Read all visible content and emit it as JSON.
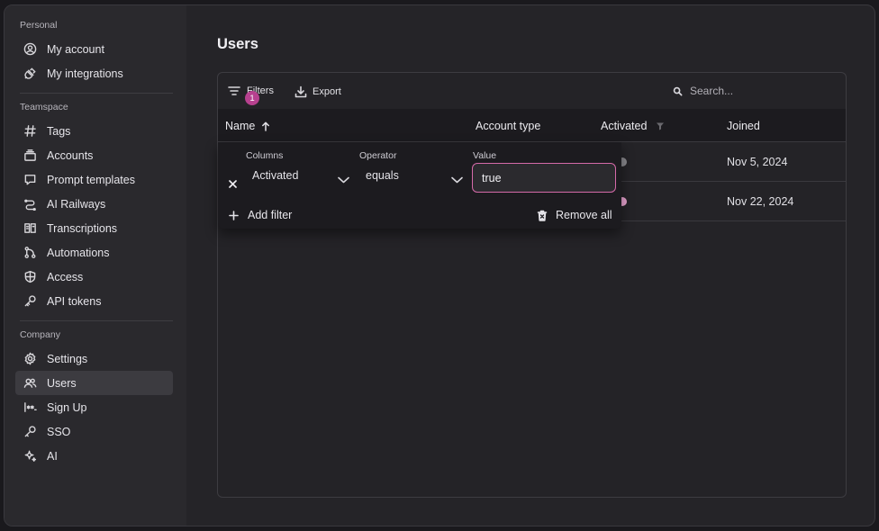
{
  "sidebar": {
    "sections": [
      {
        "label": "Personal",
        "items": [
          {
            "label": "My account",
            "icon": "user-circle-icon"
          },
          {
            "label": "My integrations",
            "icon": "plug-icon"
          }
        ]
      },
      {
        "label": "Teamspace",
        "items": [
          {
            "label": "Tags",
            "icon": "hash-icon"
          },
          {
            "label": "Accounts",
            "icon": "accounts-icon"
          },
          {
            "label": "Prompt templates",
            "icon": "chat-icon"
          },
          {
            "label": "AI Railways",
            "icon": "route-icon"
          },
          {
            "label": "Transcriptions",
            "icon": "book-icon"
          },
          {
            "label": "Automations",
            "icon": "branch-icon"
          },
          {
            "label": "Access",
            "icon": "shield-icon"
          },
          {
            "label": "API tokens",
            "icon": "key-icon"
          }
        ]
      },
      {
        "label": "Company",
        "items": [
          {
            "label": "Settings",
            "icon": "gear-icon"
          },
          {
            "label": "Users",
            "icon": "users-icon",
            "active": true
          },
          {
            "label": "Sign Up",
            "icon": "signup-icon"
          },
          {
            "label": "SSO",
            "icon": "key-icon"
          },
          {
            "label": "AI",
            "icon": "sparkle-icon"
          }
        ]
      }
    ]
  },
  "main": {
    "title": "Users",
    "toolbar": {
      "filters_label": "Filters",
      "filters_count": "1",
      "export_label": "Export",
      "search_placeholder": "Search..."
    },
    "table": {
      "headers": {
        "name": "Name",
        "account_type": "Account type",
        "activated": "Activated",
        "joined": "Joined"
      },
      "rows": [
        {
          "joined": "Nov 5, 2024",
          "activated_color": "#8a898e"
        },
        {
          "joined": "Nov 22, 2024",
          "activated_color": "#e8a3cf"
        }
      ]
    },
    "filter_popover": {
      "columns_label": "Columns",
      "operator_label": "Operator",
      "value_label": "Value",
      "column_value": "Activated",
      "operator_value": "equals",
      "value": "true",
      "add_filter_label": "Add filter",
      "remove_all_label": "Remove all"
    }
  },
  "colors": {
    "accent": "#b7418f",
    "focus_border": "#d56aa9"
  }
}
